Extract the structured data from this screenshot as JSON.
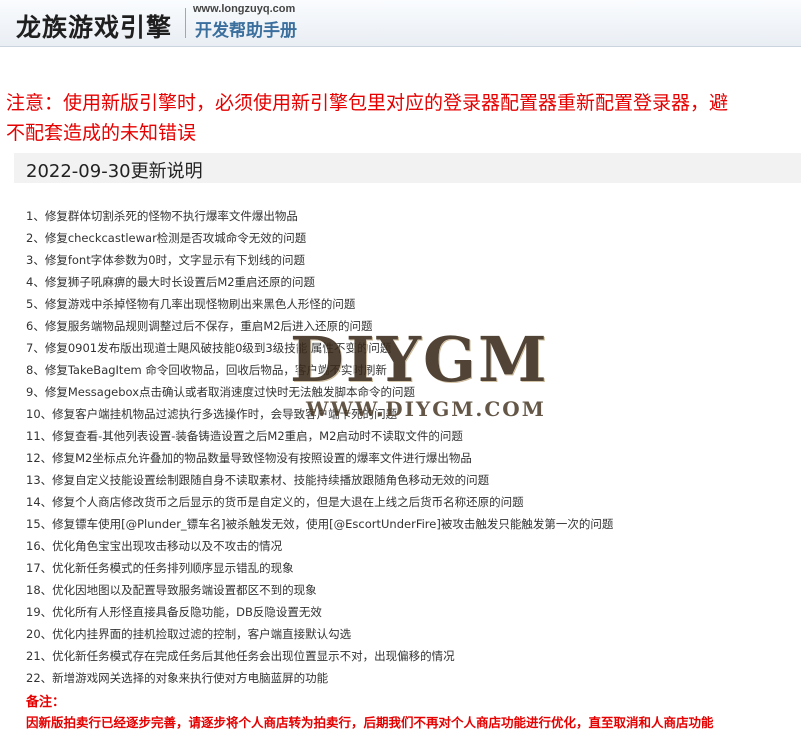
{
  "header": {
    "logo_text": "龙族游戏引擎",
    "url": "www.longzuyq.com",
    "subtitle": "开发帮助手册"
  },
  "notice": {
    "line1": "注意：使用新版引擎时，必须使用新引擎包里对应的登录器配置器重新配置登录器，避",
    "line2": "不配套造成的未知错误"
  },
  "section": {
    "title": "2022-09-30更新说明"
  },
  "changes": [
    "1、修复群体切割杀死的怪物不执行爆率文件爆出物品",
    "2、修复checkcastlewar检测是否攻城命令无效的问题",
    "3、修复font字体参数为0时，文字显示有下划线的问题",
    "4、修复狮子吼麻痹的最大时长设置后M2重启还原的问题",
    "5、修复游戏中杀掉怪物有几率出现怪物刷出来黑色人形怪的问题",
    "6、修复服务端物品规则调整过后不保存，重启M2后进入还原的问题",
    "7、修复0901发布版出现道士飓风破技能0级到3级技能 属性不变的问题",
    "8、修复TakeBagItem 命令回收物品，回收后物品，客户端不实时刷新",
    "9、修复Messagebox点击确认或者取消速度过快时无法触发脚本命令的问题",
    "10、修复客户端挂机物品过滤执行多选操作时，会导致客户端卡死的问题",
    "11、修复查看-其他列表设置-装备铸造设置之后M2重启，M2启动时不读取文件的问题",
    "12、修复M2坐标点允许叠加的物品数量导致怪物没有按照设置的爆率文件进行爆出物品",
    "13、修复自定义技能设置绘制跟随自身不读取素材、技能持续播放跟随角色移动无效的问题",
    "14、修复个人商店修改货币之后显示的货币是自定义的，但是大退在上线之后货币名称还原的问题",
    "15、修复镖车使用[@Plunder_镖车名]被杀触发无效，使用[@EscortUnderFire]被攻击触发只能触发第一次的问题",
    "16、优化角色宝宝出现攻击移动以及不攻击的情况",
    "17、优化新任务模式的任务排列顺序显示错乱的现象",
    "18、优化因地图以及配置导致服务端设置都区不到的现象",
    "19、优化所有人形怪直接具备反隐功能，DB反隐设置无效",
    "20、优化内挂界面的挂机捡取过滤的控制，客户端直接默认勾选",
    "21、优化新任务模式存在完成任务后其他任务会出现位置显示不对，出现偏移的情况",
    "22、新增游戏网关选择的对象来执行使对方电脑蓝屏的功能"
  ],
  "remark": {
    "label": "备注：",
    "text": "因新版拍卖行已经逐步完善，请逐步将个人商店转为拍卖行，后期我们不再对个人商店功能进行优化，直至取消和人商店功能"
  },
  "watermark": {
    "main": "DIYGM",
    "sub": "WWW.DIYGM.COM"
  },
  "colors": {
    "notice_red": "#e60000",
    "subtitle_blue": "#3b6f9e",
    "title_bar_gray": "#f2f2f2"
  }
}
